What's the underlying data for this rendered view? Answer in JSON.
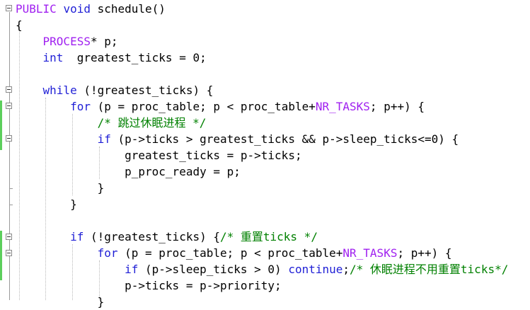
{
  "editor": {
    "lines": [
      [
        {
          "t": "PUBLIC",
          "c": "mac"
        },
        {
          "t": " "
        },
        {
          "t": "void",
          "c": "kw"
        },
        {
          "t": " schedule()"
        }
      ],
      [
        {
          "t": "{"
        }
      ],
      [
        {
          "t": "    "
        },
        {
          "t": "PROCESS",
          "c": "mac"
        },
        {
          "t": "* p;"
        }
      ],
      [
        {
          "t": "    "
        },
        {
          "t": "int",
          "c": "kw"
        },
        {
          "t": "  greatest_ticks = 0;"
        }
      ],
      [
        {
          "t": ""
        }
      ],
      [
        {
          "t": "    "
        },
        {
          "t": "while",
          "c": "kw"
        },
        {
          "t": " (!greatest_ticks) {"
        }
      ],
      [
        {
          "t": "        "
        },
        {
          "t": "for",
          "c": "kw"
        },
        {
          "t": " (p = proc_table; p < proc_table+"
        },
        {
          "t": "NR_TASKS",
          "c": "mac"
        },
        {
          "t": "; p++) {"
        }
      ],
      [
        {
          "t": "            "
        },
        {
          "t": "/* 跳过休眠进程 */",
          "c": "cm"
        }
      ],
      [
        {
          "t": "            "
        },
        {
          "t": "if",
          "c": "kw"
        },
        {
          "t": " (p->ticks > greatest_ticks && p->sleep_ticks<=0) {"
        }
      ],
      [
        {
          "t": "                greatest_ticks = p->ticks;"
        }
      ],
      [
        {
          "t": "                p_proc_ready = p;"
        }
      ],
      [
        {
          "t": "            }"
        }
      ],
      [
        {
          "t": "        }"
        }
      ],
      [
        {
          "t": ""
        }
      ],
      [
        {
          "t": "        "
        },
        {
          "t": "if",
          "c": "kw"
        },
        {
          "t": " (!greatest_ticks) {"
        },
        {
          "t": "/* 重置ticks */",
          "c": "cm"
        }
      ],
      [
        {
          "t": "            "
        },
        {
          "t": "for",
          "c": "kw"
        },
        {
          "t": " (p = proc_table; p < proc_table+"
        },
        {
          "t": "NR_TASKS",
          "c": "mac"
        },
        {
          "t": "; p++) {"
        }
      ],
      [
        {
          "t": "                "
        },
        {
          "t": "if",
          "c": "kw"
        },
        {
          "t": " (p->sleep_ticks > 0) "
        },
        {
          "t": "continue",
          "c": "kw"
        },
        {
          "t": ";"
        },
        {
          "t": "/* 休眠进程不用重置ticks*/",
          "c": "cm"
        }
      ],
      [
        {
          "t": "                p->ticks = p->priority;"
        }
      ],
      [
        {
          "t": "            }"
        }
      ]
    ]
  }
}
